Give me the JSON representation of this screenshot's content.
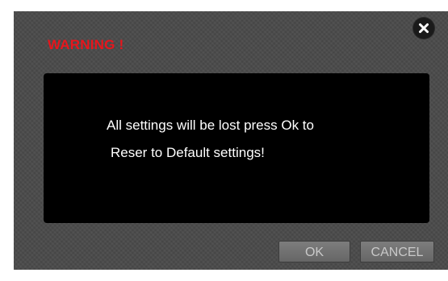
{
  "dialog": {
    "title": "WARNING !",
    "message_line_1": "All settings will be lost press Ok to",
    "message_line_2": "Reser to Default settings!",
    "close_icon": "close-icon",
    "ok_label": "OK",
    "cancel_label": "CANCEL"
  },
  "colors": {
    "title": "#e8151c",
    "dialog_background": "#4a4a4a",
    "message_background": "#000000",
    "message_text": "#ffffff",
    "button_background": "#6e6e6e",
    "button_text": "#c9c9c9"
  }
}
